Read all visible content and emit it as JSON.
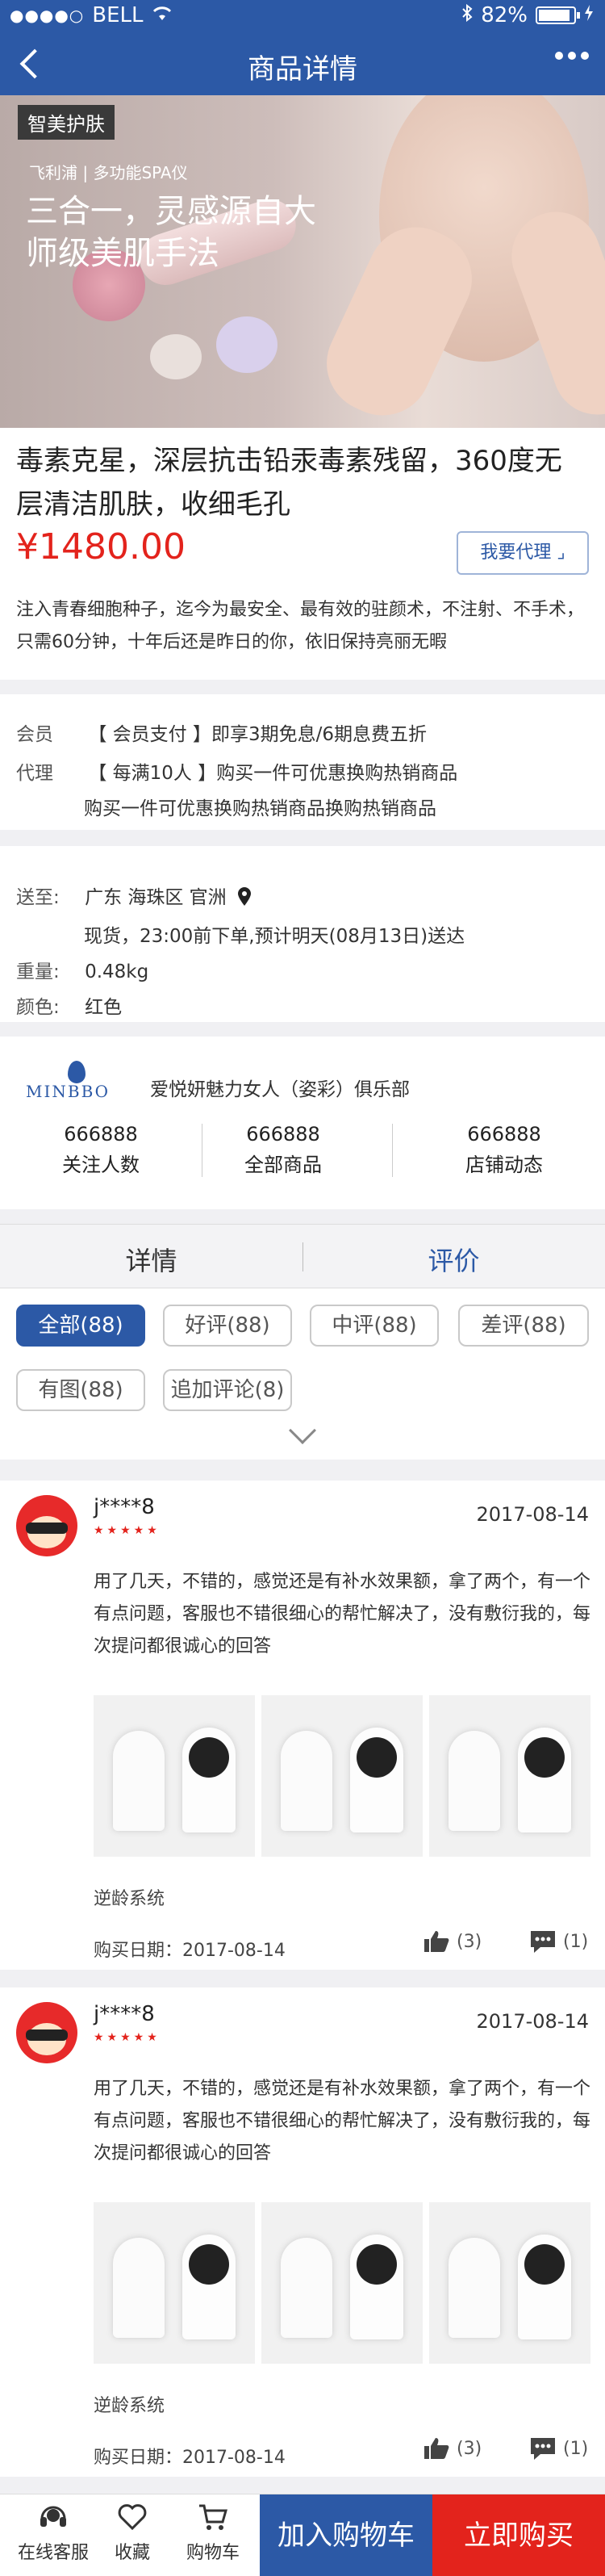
{
  "status_bar": {
    "carrier": "BELL",
    "battery": "82%"
  },
  "nav": {
    "title": "商品详情"
  },
  "banner": {
    "tag": "智美护肤",
    "subtitle": "飞利浦 | 多功能SPA仪",
    "headline": "三合一，灵感源自大师级美肌手法"
  },
  "product": {
    "title": "毒素克星，深层抗击铅汞毒素残留，360度无层清洁肌肤，收细毛孔",
    "price": "¥1480.00",
    "agent_button": "我要代理",
    "description": "注入青春细胞种子，迄今为最安全、最有效的驻颜术，不注射、不手术，只需60分钟，十年后还是昨日的你，依旧保持亮丽无暇"
  },
  "promo": {
    "member_label": "会员",
    "member_tag": "【 会员支付 】",
    "member_text": "即享3期免息/6期息费五折",
    "agent_label": "代理",
    "agent_tag": "【 每满10人 】",
    "agent_text": "购买一件可优惠换购热销商品",
    "agent_text2": "购买一件可优惠换购热销商品换购热销商品"
  },
  "shipping": {
    "ship_label": "送至:",
    "location": "广东  海珠区  官洲",
    "delivery": "现货，23:00前下单,预计明天(08月13日)送达",
    "weight_label": "重量:",
    "weight": "0.48kg",
    "color_label": "颜色:",
    "color": "红色"
  },
  "shop": {
    "logo_text": "MINBBO",
    "name": "爱悦妍魅力女人（姿彩）俱乐部",
    "stats": [
      {
        "value": "666888",
        "label": "关注人数"
      },
      {
        "value": "666888",
        "label": "全部商品"
      },
      {
        "value": "666888",
        "label": "店铺动态"
      }
    ]
  },
  "tabs": [
    {
      "label": "详情"
    },
    {
      "label": "评价"
    }
  ],
  "filters": [
    {
      "label": "全部(88)"
    },
    {
      "label": "好评(88)"
    },
    {
      "label": "中评(88)"
    },
    {
      "label": "差评(88)"
    },
    {
      "label": "有图(88)"
    },
    {
      "label": "追加评论(8)"
    }
  ],
  "reviews": [
    {
      "user": "j****8",
      "stars": "★★★★★",
      "date": "2017-08-14",
      "text": "用了几天，不错的，感觉还是有补水效果额，拿了两个，有一个有点问题，客服也不错很细心的帮忙解决了，没有敷衍我的，每次提问都很诚心的回答",
      "spec": "逆龄系统",
      "purchase": "购买日期：2017-08-14",
      "likes": "(3)",
      "comments": "(1)"
    },
    {
      "user": "j****8",
      "stars": "★★★★★",
      "date": "2017-08-14",
      "text": "用了几天，不错的，感觉还是有补水效果额，拿了两个，有一个有点问题，客服也不错很细心的帮忙解决了，没有敷衍我的，每次提问都很诚心的回答",
      "spec": "逆龄系统",
      "purchase": "购买日期：2017-08-14",
      "likes": "(3)",
      "comments": "(1)"
    }
  ],
  "bottom_bar": {
    "service": "在线客服",
    "favorite": "收藏",
    "cart": "购物车",
    "add_to_cart": "加入购物车",
    "buy_now": "立即购买"
  },
  "colors": {
    "primary": "#2c59a6",
    "price": "#e3231c"
  }
}
